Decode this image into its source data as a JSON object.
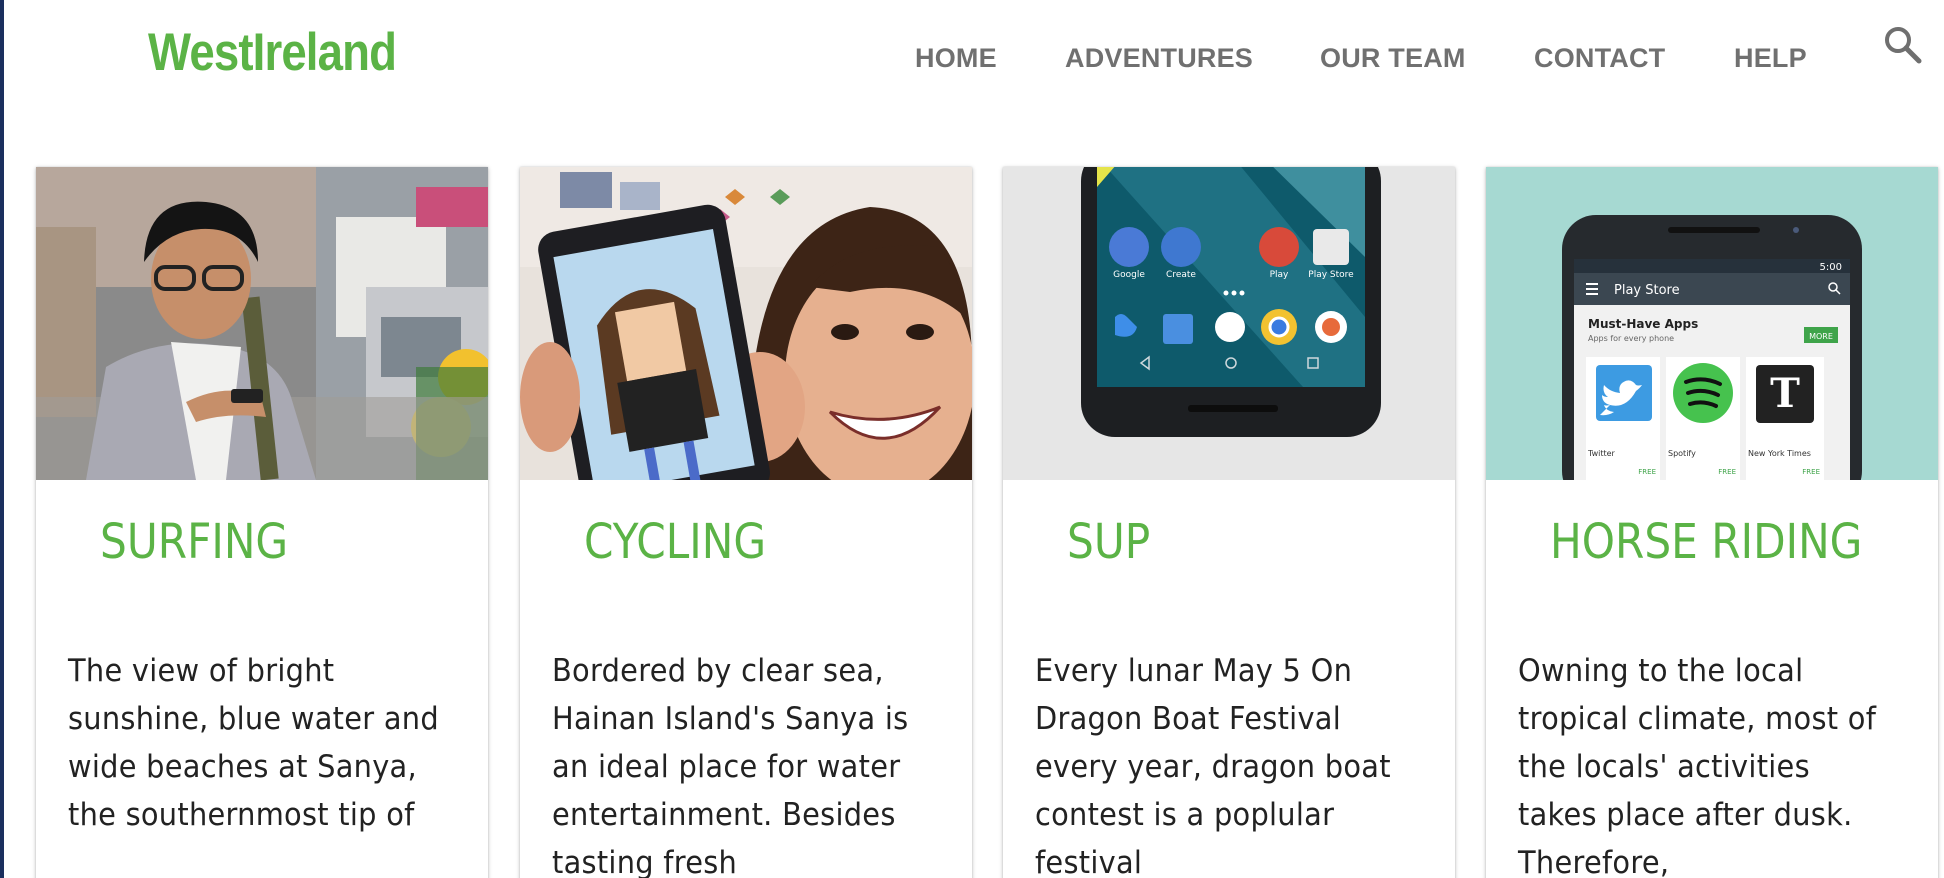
{
  "site": {
    "logo": "WestIreland"
  },
  "nav": {
    "items": [
      "HOME",
      "ADVENTURES",
      "OUR TEAM",
      "CONTACT",
      "HELP"
    ],
    "search_icon": "search-icon"
  },
  "colors": {
    "accent": "#5bb346",
    "nav_text": "#707070",
    "body_text": "#222222"
  },
  "cards": [
    {
      "title": "SURFING",
      "image": "man-with-smartphone-street-photo",
      "description": "The view of bright sunshine, blue water and wide beaches at Sanya, the southernmost tip of"
    },
    {
      "title": "CYCLING",
      "image": "girl-holding-tablet-photo",
      "description": "Bordered by clear sea, Hainan Island's Sanya is an ideal place for water entertainment. Besides tasting fresh"
    },
    {
      "title": "SUP",
      "image": "android-phone-homescreen",
      "description": "Every lunar May 5 On Dragon Boat Festival every year, dragon boat contest is a poplular festival"
    },
    {
      "title": "HORSE RIDING",
      "image": "phone-play-store-screen",
      "description": "Owning to the local tropical climate, most of the locals' activities takes place after dusk. Therefore,"
    }
  ],
  "phone_screens": {
    "homescreen_apps": [
      "Google",
      "Create",
      "Play",
      "Play Store"
    ],
    "play_store": {
      "status_time": "5:00",
      "app_bar_title": "Play Store",
      "section_title": "Must-Have Apps",
      "section_subtitle": "Apps for every phone",
      "more_label": "MORE",
      "apps": [
        {
          "name": "Twitter",
          "price": "FREE"
        },
        {
          "name": "Spotify",
          "price": "FREE"
        },
        {
          "name": "New York Times",
          "price": "FREE"
        }
      ]
    }
  }
}
